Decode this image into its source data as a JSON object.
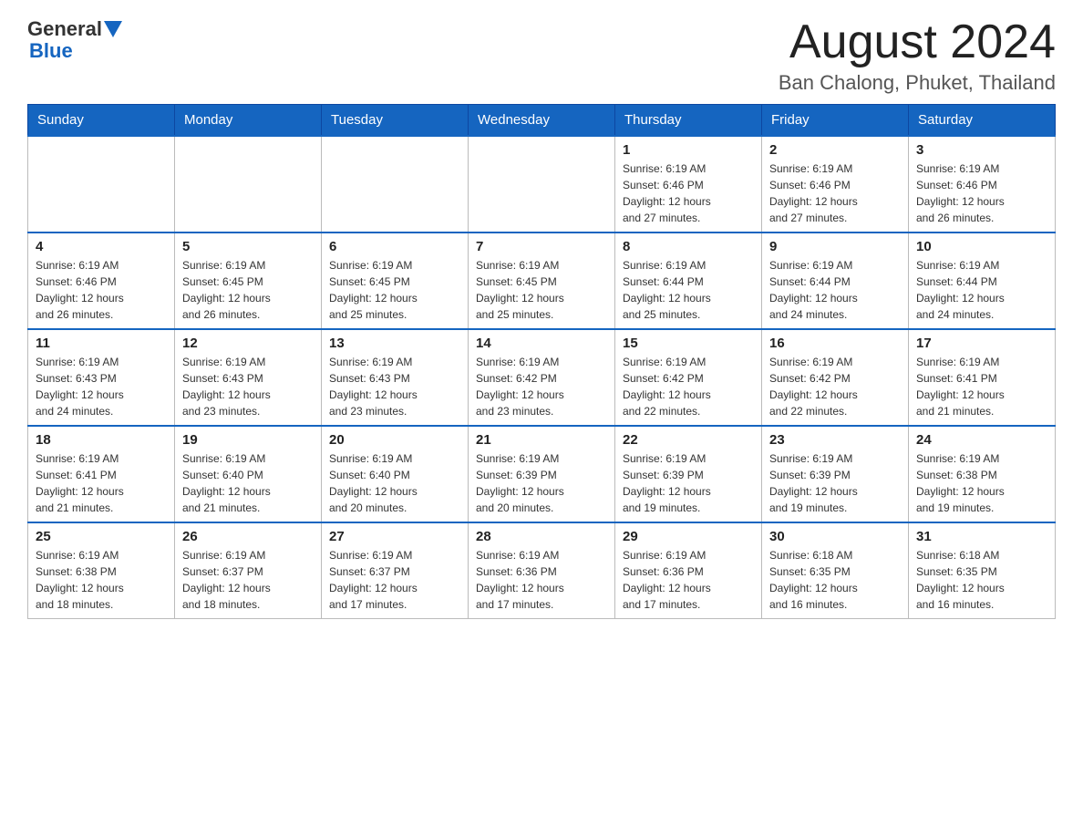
{
  "header": {
    "logo_general": "General",
    "logo_blue": "Blue",
    "month_title": "August 2024",
    "location": "Ban Chalong, Phuket, Thailand"
  },
  "weekdays": [
    "Sunday",
    "Monday",
    "Tuesday",
    "Wednesday",
    "Thursday",
    "Friday",
    "Saturday"
  ],
  "weeks": [
    [
      {
        "day": "",
        "info": ""
      },
      {
        "day": "",
        "info": ""
      },
      {
        "day": "",
        "info": ""
      },
      {
        "day": "",
        "info": ""
      },
      {
        "day": "1",
        "info": "Sunrise: 6:19 AM\nSunset: 6:46 PM\nDaylight: 12 hours\nand 27 minutes."
      },
      {
        "day": "2",
        "info": "Sunrise: 6:19 AM\nSunset: 6:46 PM\nDaylight: 12 hours\nand 27 minutes."
      },
      {
        "day": "3",
        "info": "Sunrise: 6:19 AM\nSunset: 6:46 PM\nDaylight: 12 hours\nand 26 minutes."
      }
    ],
    [
      {
        "day": "4",
        "info": "Sunrise: 6:19 AM\nSunset: 6:46 PM\nDaylight: 12 hours\nand 26 minutes."
      },
      {
        "day": "5",
        "info": "Sunrise: 6:19 AM\nSunset: 6:45 PM\nDaylight: 12 hours\nand 26 minutes."
      },
      {
        "day": "6",
        "info": "Sunrise: 6:19 AM\nSunset: 6:45 PM\nDaylight: 12 hours\nand 25 minutes."
      },
      {
        "day": "7",
        "info": "Sunrise: 6:19 AM\nSunset: 6:45 PM\nDaylight: 12 hours\nand 25 minutes."
      },
      {
        "day": "8",
        "info": "Sunrise: 6:19 AM\nSunset: 6:44 PM\nDaylight: 12 hours\nand 25 minutes."
      },
      {
        "day": "9",
        "info": "Sunrise: 6:19 AM\nSunset: 6:44 PM\nDaylight: 12 hours\nand 24 minutes."
      },
      {
        "day": "10",
        "info": "Sunrise: 6:19 AM\nSunset: 6:44 PM\nDaylight: 12 hours\nand 24 minutes."
      }
    ],
    [
      {
        "day": "11",
        "info": "Sunrise: 6:19 AM\nSunset: 6:43 PM\nDaylight: 12 hours\nand 24 minutes."
      },
      {
        "day": "12",
        "info": "Sunrise: 6:19 AM\nSunset: 6:43 PM\nDaylight: 12 hours\nand 23 minutes."
      },
      {
        "day": "13",
        "info": "Sunrise: 6:19 AM\nSunset: 6:43 PM\nDaylight: 12 hours\nand 23 minutes."
      },
      {
        "day": "14",
        "info": "Sunrise: 6:19 AM\nSunset: 6:42 PM\nDaylight: 12 hours\nand 23 minutes."
      },
      {
        "day": "15",
        "info": "Sunrise: 6:19 AM\nSunset: 6:42 PM\nDaylight: 12 hours\nand 22 minutes."
      },
      {
        "day": "16",
        "info": "Sunrise: 6:19 AM\nSunset: 6:42 PM\nDaylight: 12 hours\nand 22 minutes."
      },
      {
        "day": "17",
        "info": "Sunrise: 6:19 AM\nSunset: 6:41 PM\nDaylight: 12 hours\nand 21 minutes."
      }
    ],
    [
      {
        "day": "18",
        "info": "Sunrise: 6:19 AM\nSunset: 6:41 PM\nDaylight: 12 hours\nand 21 minutes."
      },
      {
        "day": "19",
        "info": "Sunrise: 6:19 AM\nSunset: 6:40 PM\nDaylight: 12 hours\nand 21 minutes."
      },
      {
        "day": "20",
        "info": "Sunrise: 6:19 AM\nSunset: 6:40 PM\nDaylight: 12 hours\nand 20 minutes."
      },
      {
        "day": "21",
        "info": "Sunrise: 6:19 AM\nSunset: 6:39 PM\nDaylight: 12 hours\nand 20 minutes."
      },
      {
        "day": "22",
        "info": "Sunrise: 6:19 AM\nSunset: 6:39 PM\nDaylight: 12 hours\nand 19 minutes."
      },
      {
        "day": "23",
        "info": "Sunrise: 6:19 AM\nSunset: 6:39 PM\nDaylight: 12 hours\nand 19 minutes."
      },
      {
        "day": "24",
        "info": "Sunrise: 6:19 AM\nSunset: 6:38 PM\nDaylight: 12 hours\nand 19 minutes."
      }
    ],
    [
      {
        "day": "25",
        "info": "Sunrise: 6:19 AM\nSunset: 6:38 PM\nDaylight: 12 hours\nand 18 minutes."
      },
      {
        "day": "26",
        "info": "Sunrise: 6:19 AM\nSunset: 6:37 PM\nDaylight: 12 hours\nand 18 minutes."
      },
      {
        "day": "27",
        "info": "Sunrise: 6:19 AM\nSunset: 6:37 PM\nDaylight: 12 hours\nand 17 minutes."
      },
      {
        "day": "28",
        "info": "Sunrise: 6:19 AM\nSunset: 6:36 PM\nDaylight: 12 hours\nand 17 minutes."
      },
      {
        "day": "29",
        "info": "Sunrise: 6:19 AM\nSunset: 6:36 PM\nDaylight: 12 hours\nand 17 minutes."
      },
      {
        "day": "30",
        "info": "Sunrise: 6:18 AM\nSunset: 6:35 PM\nDaylight: 12 hours\nand 16 minutes."
      },
      {
        "day": "31",
        "info": "Sunrise: 6:18 AM\nSunset: 6:35 PM\nDaylight: 12 hours\nand 16 minutes."
      }
    ]
  ]
}
